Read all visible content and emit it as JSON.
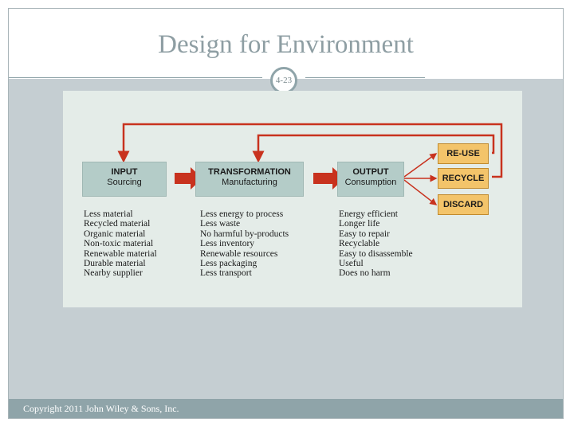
{
  "slide": {
    "title": "Design for Environment",
    "number": "4-23",
    "copyright": "Copyright 2011 John Wiley & Sons, Inc."
  },
  "diagram": {
    "stages": [
      {
        "title": "INPUT",
        "subtitle": "Sourcing"
      },
      {
        "title": "TRANSFORMATION",
        "subtitle": "Manufacturing"
      },
      {
        "title": "OUTPUT",
        "subtitle": "Consumption"
      }
    ],
    "destinations": [
      "RE-USE",
      "RECYCLE",
      "DISCARD"
    ],
    "input_items": [
      "Less material",
      "Recycled material",
      "Organic material",
      "Non-toxic material",
      "Renewable material",
      "Durable material",
      "Nearby supplier"
    ],
    "transformation_items": [
      "Less energy to process",
      "Less waste",
      "No harmful by-products",
      "Less inventory",
      "Renewable resources",
      "Less packaging",
      "Less transport"
    ],
    "output_items": [
      "Energy efficient",
      "Longer life",
      "Easy to repair",
      "Recyclable",
      "Easy to disassemble",
      "Useful",
      "Does no harm"
    ],
    "colors": {
      "stage_box": "#b4ccc8",
      "destination_box": "#f3c46a",
      "arrow": "#c8321e",
      "panel": "#e4ece8",
      "accent": "#8fa4a9"
    }
  }
}
